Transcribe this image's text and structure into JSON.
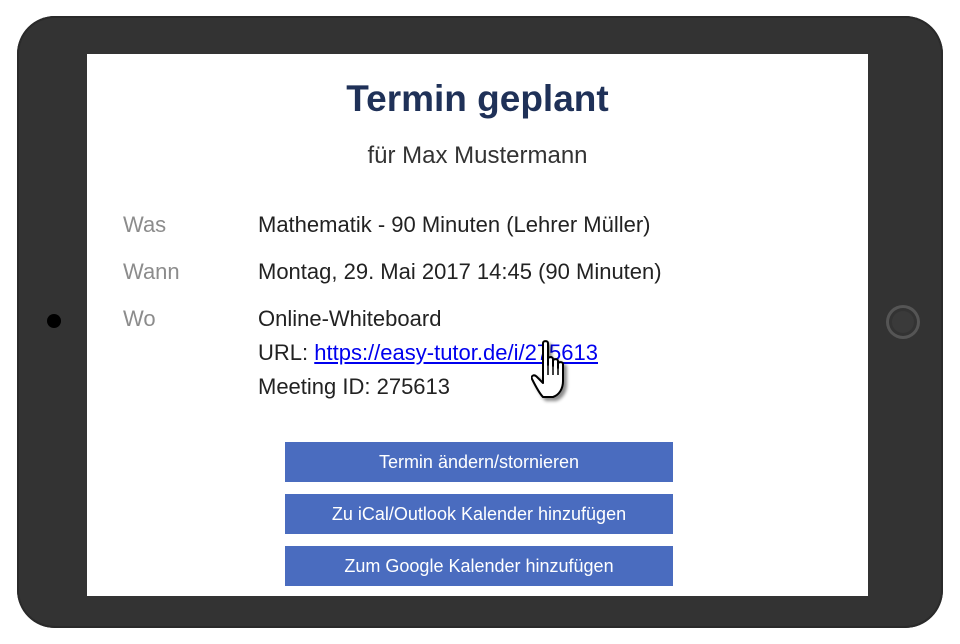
{
  "confirmation": {
    "title": "Termin geplant",
    "subtitle": "für Max Mustermann"
  },
  "details": {
    "what_label": "Was",
    "what_value": "Mathematik - 90 Minuten (Lehrer Müller)",
    "when_label": "Wann",
    "when_value": "Montag, 29. Mai 2017 14:45 (90 Minuten)",
    "where_label": "Wo",
    "where_value": "Online-Whiteboard",
    "url_prefix": "URL: ",
    "url_link": "https://easy-tutor.de/i/275613",
    "meeting_id": "Meeting ID: 275613"
  },
  "actions": {
    "change_label": "Termin ändern/stornieren",
    "ical_label": "Zu iCal/Outlook Kalender hinzufügen",
    "google_label": "Zum Google Kalender hinzufügen"
  },
  "colors": {
    "button_bg": "#4a6cbf",
    "title": "#1f3158",
    "link": "#0000ee",
    "device": "#333333"
  },
  "icons": {
    "cursor": "hand-pointer-icon"
  }
}
